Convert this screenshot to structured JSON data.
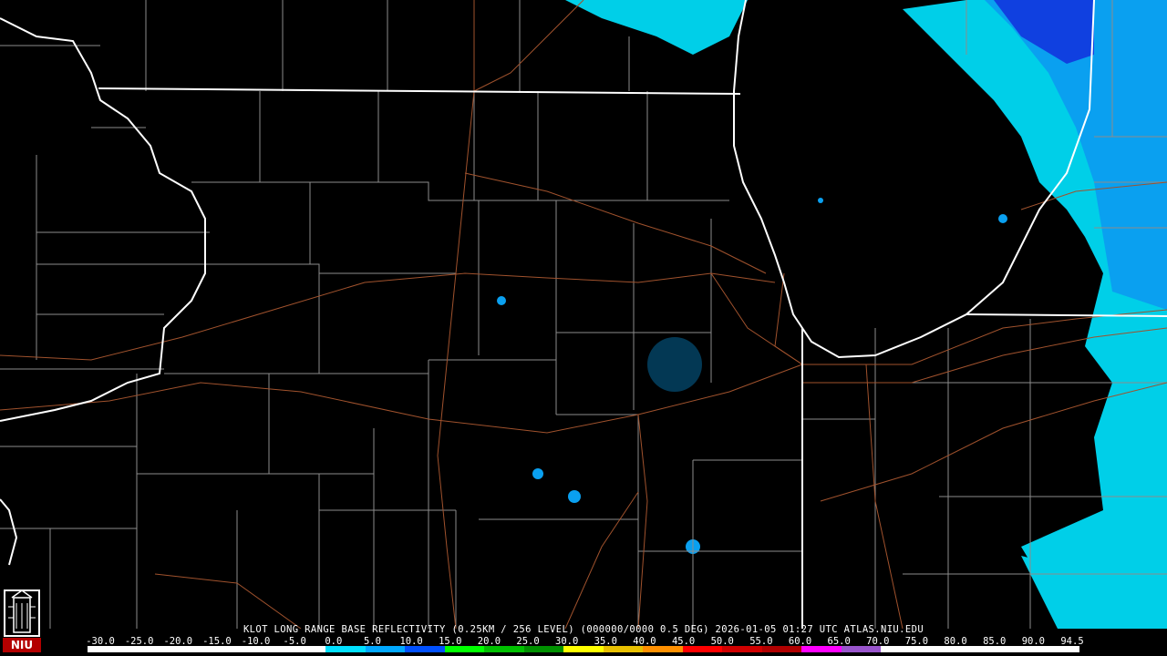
{
  "caption": "KLOT LONG RANGE BASE REFLECTIVITY (0.25KM / 256 LEVEL) (000000/0000 0.5 DEG) 2026-01-05 01:27 UTC  ATLAS.NIU.EDU",
  "logo": {
    "text": "NIU",
    "brand_color": "#b30000"
  },
  "scale": {
    "ticks": [
      "-30.0",
      "-25.0",
      "-20.0",
      "-15.0",
      "-10.0",
      "-5.0",
      "0.0",
      "5.0",
      "10.0",
      "15.0",
      "20.0",
      "25.0",
      "30.0",
      "35.0",
      "40.0",
      "45.0",
      "50.0",
      "55.0",
      "60.0",
      "65.0",
      "70.0",
      "75.0",
      "80.0",
      "85.0",
      "90.0",
      "94.5"
    ],
    "colors": [
      "#ffffff",
      "#ffffff",
      "#ffffff",
      "#ffffff",
      "#ffffff",
      "#ffffff",
      "#00e0ff",
      "#00a8ff",
      "#0050ff",
      "#00ff00",
      "#00c000",
      "#009000",
      "#ffff00",
      "#e8c000",
      "#ff9000",
      "#ff0000",
      "#d00000",
      "#b00000",
      "#ff00ff",
      "#9955cc",
      "#ffffff",
      "#ffffff",
      "#ffffff",
      "#ffffff",
      "#ffffff"
    ]
  },
  "map_colors": {
    "state": "#ffffff",
    "county": "#8c8c8c",
    "road": "#a0522d",
    "echo_light": "#00cfe8",
    "echo_mid": "#0aa0f0",
    "echo_heavy": "#1040e0"
  }
}
